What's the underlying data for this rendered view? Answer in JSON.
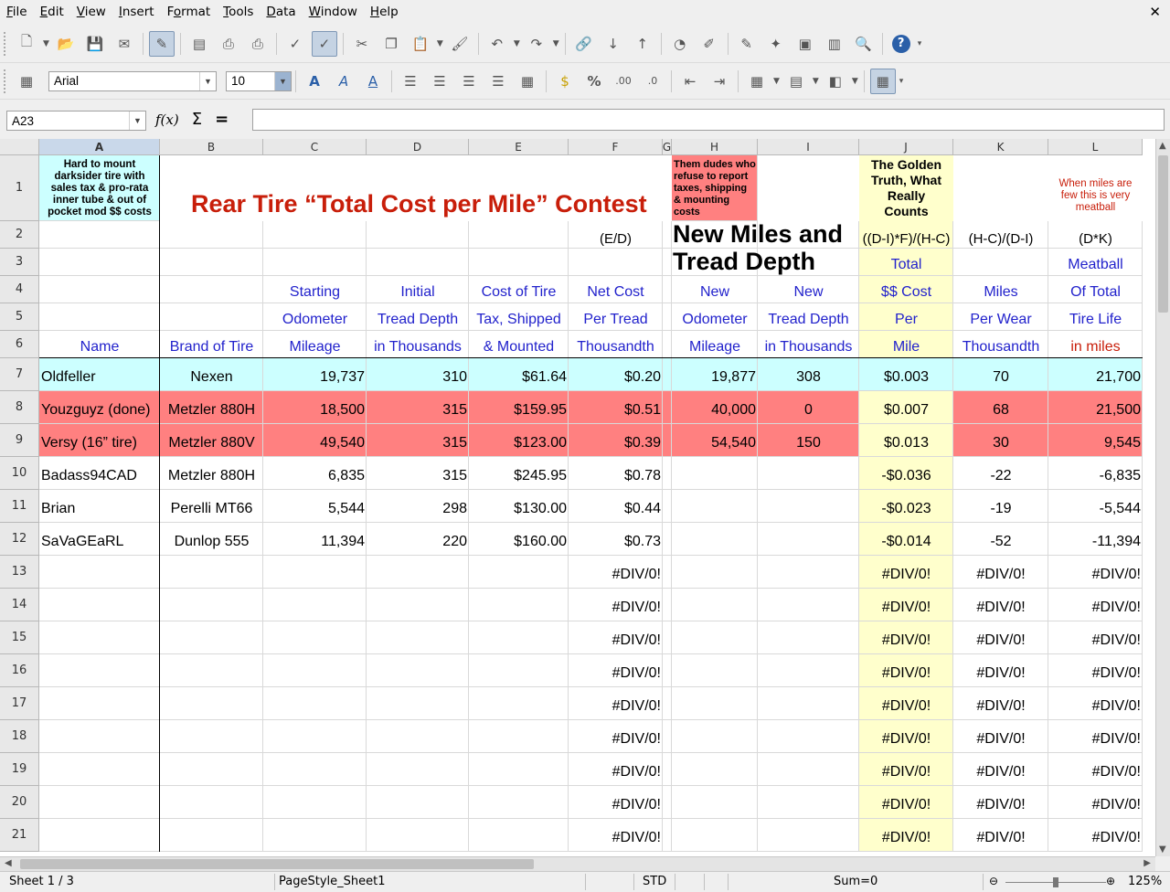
{
  "menu": [
    "File",
    "Edit",
    "View",
    "Insert",
    "Format",
    "Tools",
    "Data",
    "Window",
    "Help"
  ],
  "menu_underline": [
    "F",
    "E",
    "V",
    "I",
    "o",
    "T",
    "D",
    "W",
    "H"
  ],
  "font_name": "Arial",
  "font_size": "10",
  "namebox": "A23",
  "columns": [
    "A",
    "B",
    "C",
    "D",
    "E",
    "F",
    "G",
    "H",
    "I",
    "J",
    "K",
    "L"
  ],
  "rows": [
    "1",
    "2",
    "3",
    "4",
    "5",
    "6",
    "7",
    "8",
    "9",
    "10",
    "11",
    "12",
    "13",
    "14",
    "15",
    "16",
    "17",
    "18",
    "19",
    "20",
    "21"
  ],
  "title": "Rear Tire “Total Cost per Mile” Contest",
  "notes": {
    "a1": "Hard to mount darksider tire with sales tax & pro-rata inner tube & out of pocket mod $$ costs",
    "h1": "Them dudes who refuse to report taxes, shipping & mounting costs",
    "j1": "The Golden Truth, What Really Counts",
    "l1": "When miles are few this is very meatball"
  },
  "h23": "New Miles and Tread Depth",
  "formulas": {
    "f": "(E/D)",
    "j": "((D-I)*F)/(H-C)",
    "k": "(H-C)/(D-I)",
    "l": "(D*K)"
  },
  "headers": {
    "r3": {
      "j": "Total",
      "l": "Meatball"
    },
    "r4": {
      "c": "Starting",
      "d": "Initial",
      "e": "Cost of Tire",
      "f": "Net Cost",
      "h": "New",
      "i": "New",
      "j": "$$ Cost",
      "k": "Miles",
      "l": "Of Total"
    },
    "r5": {
      "c": "Odometer",
      "d": "Tread Depth",
      "e": "Tax, Shipped",
      "f": "Per Tread",
      "h": "Odometer",
      "i": "Tread Depth",
      "j": "Per",
      "k": "Per Wear",
      "l": "Tire Life"
    },
    "r6": {
      "a": "Name",
      "b": "Brand of Tire",
      "c": "Mileage",
      "d": "in Thousands",
      "e": "& Mounted",
      "f": "Thousandth",
      "h": "Mileage",
      "i": "in Thousands",
      "j": "Mile",
      "k": "Thousandth",
      "l": "in miles"
    }
  },
  "data_rows": [
    {
      "a": "Oldfeller",
      "b": "Nexen",
      "c": "19,737",
      "d": "310",
      "e": "$61.64",
      "f": "$0.20",
      "h": "19,877",
      "i": "308",
      "j": "$0.003",
      "k": "70",
      "l": "21,700"
    },
    {
      "a": "Youzguyz (done)",
      "b": "Metzler 880H",
      "c": "18,500",
      "d": "315",
      "e": "$159.95",
      "f": "$0.51",
      "h": "40,000",
      "i": "0",
      "j": "$0.007",
      "k": "68",
      "l": "21,500"
    },
    {
      "a": "Versy (16” tire)",
      "b": "Metzler 880V",
      "c": "49,540",
      "d": "315",
      "e": "$123.00",
      "f": "$0.39",
      "h": "54,540",
      "i": "150",
      "j": "$0.013",
      "k": "30",
      "l": "9,545"
    },
    {
      "a": "Badass94CAD",
      "b": "Metzler 880H",
      "c": "6,835",
      "d": "315",
      "e": "$245.95",
      "f": "$0.78",
      "h": "",
      "i": "",
      "j": "-$0.036",
      "k": "-22",
      "l": "-6,835"
    },
    {
      "a": "Brian",
      "b": "Perelli MT66",
      "c": "5,544",
      "d": "298",
      "e": "$130.00",
      "f": "$0.44",
      "h": "",
      "i": "",
      "j": "-$0.023",
      "k": "-19",
      "l": "-5,544"
    },
    {
      "a": "SaVaGEaRL",
      "b": "Dunlop 555",
      "c": "11,394",
      "d": "220",
      "e": "$160.00",
      "f": "$0.73",
      "h": "",
      "i": "",
      "j": "-$0.014",
      "k": "-52",
      "l": "-11,394"
    }
  ],
  "div_error": "#DIV/0!",
  "colors": {
    "cyan": "#ccffff",
    "red": "#ff8080",
    "yellow": "#ffffcc",
    "red_text": "#c81e0a",
    "blue_text": "#2222cc"
  },
  "status": {
    "sheet": "Sheet 1 / 3",
    "pagestyle": "PageStyle_Sheet1",
    "mode": "STD",
    "sum": "Sum=0",
    "zoom": "125%"
  }
}
